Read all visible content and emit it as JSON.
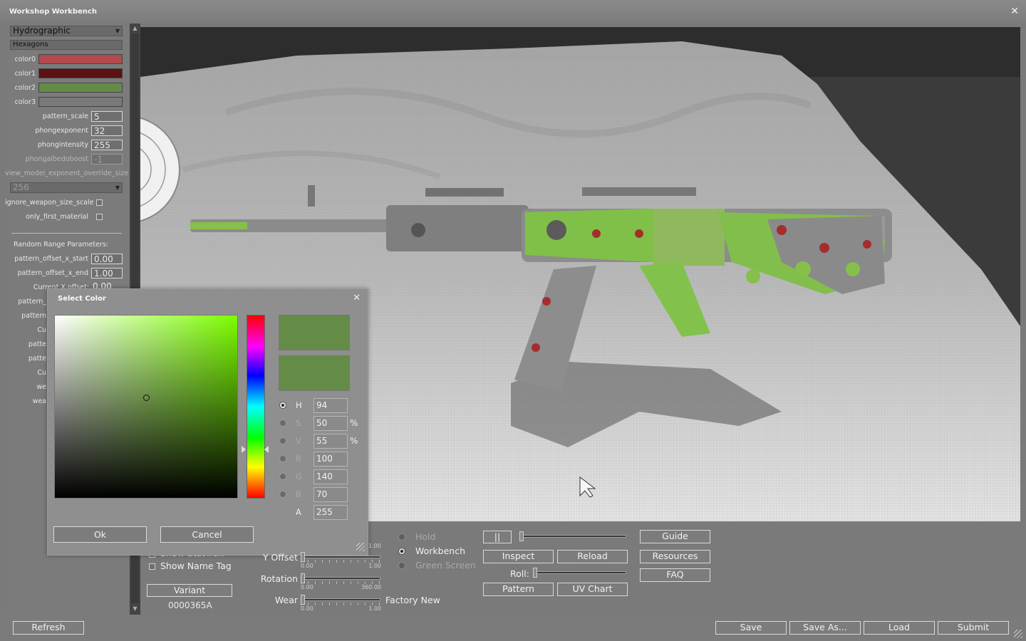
{
  "window": {
    "title": "Workshop Workbench"
  },
  "left_panel": {
    "material_type": "Hydrographic",
    "pattern_name": "Hexagons",
    "colors": [
      {
        "label": "color0",
        "hex": "#b24a4f"
      },
      {
        "label": "color1",
        "hex": "#5c1214"
      },
      {
        "label": "color2",
        "hex": "#648c46"
      },
      {
        "label": "color3",
        "hex": "#7a7a7a"
      }
    ],
    "params": [
      {
        "label": "pattern_scale",
        "value": "5"
      },
      {
        "label": "phongexponent",
        "value": "32"
      },
      {
        "label": "phongintensity",
        "value": "255"
      },
      {
        "label": "phongalbedoboost",
        "value": "-1"
      }
    ],
    "view_model_label": "view_model_exponent_override_size",
    "view_model_value": "256",
    "checks": [
      {
        "label": "ignore_weapon_size_scale"
      },
      {
        "label": "only_first_material"
      }
    ],
    "random_range_header": "Random Range Parameters:",
    "ranges": [
      {
        "label": "pattern_offset_x_start",
        "value": "0.00"
      },
      {
        "label": "pattern_offset_x_end",
        "value": "1.00"
      }
    ],
    "partial_labels": [
      "Current X offset:",
      "pattern_",
      "pattern",
      "Cu",
      "patte",
      "patte",
      "Cu",
      "we",
      "wea"
    ],
    "partial_value": "0.00"
  },
  "controls": {
    "show_stattrak": "Show StatTrak",
    "show_name_tag": "Show Name Tag",
    "variant_button": "Variant",
    "variant_code": "0000365A",
    "sliders": [
      {
        "label": "Y Offset",
        "min": "0.00",
        "max": "1.00",
        "value": 0.0
      },
      {
        "label": "Rotation",
        "min": "0.00",
        "max": "360.00",
        "value": 0.0
      },
      {
        "label": "Wear",
        "min": "0.00",
        "max": "1.00",
        "value": 0.0
      }
    ],
    "top_slider_max": "1.00",
    "wear_name": "Factory New",
    "radios": [
      {
        "label": "Hold",
        "on": false,
        "dim": true
      },
      {
        "label": "Workbench",
        "on": true,
        "dim": false
      },
      {
        "label": "Green Screen",
        "on": false,
        "dim": true
      }
    ],
    "pause_label": "||",
    "inspect": "Inspect",
    "reload": "Reload",
    "roll_label": "Roll:",
    "pattern": "Pattern",
    "uv_chart": "UV Chart",
    "guide": "Guide",
    "resources": "Resources",
    "faq": "FAQ"
  },
  "bottom": {
    "refresh": "Refresh",
    "save": "Save",
    "save_as": "Save As...",
    "load": "Load",
    "submit": "Submit"
  },
  "color_dialog": {
    "title": "Select Color",
    "current_hex": "#648c46",
    "hue_hex": "#7cfe00",
    "channels": [
      {
        "key": "H",
        "value": "94",
        "unit": "",
        "selected": true
      },
      {
        "key": "S",
        "value": "50",
        "unit": "%",
        "selected": false
      },
      {
        "key": "V",
        "value": "55",
        "unit": "%",
        "selected": false
      },
      {
        "key": "R",
        "value": "100",
        "unit": "",
        "selected": false
      },
      {
        "key": "G",
        "value": "140",
        "unit": "",
        "selected": false
      },
      {
        "key": "B",
        "value": "70",
        "unit": "",
        "selected": false
      },
      {
        "key": "A",
        "value": "255",
        "unit": "",
        "selected": false
      }
    ],
    "saturation": 0.5,
    "brightness": 0.55,
    "hue_fraction": 0.74,
    "ok": "Ok",
    "cancel": "Cancel"
  }
}
